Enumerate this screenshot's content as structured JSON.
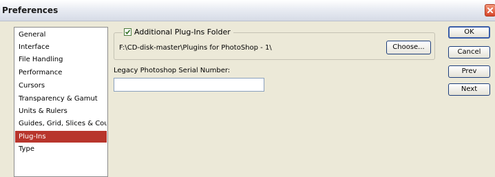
{
  "window": {
    "title": "Preferences"
  },
  "categories": [
    {
      "label": "General",
      "selected": false
    },
    {
      "label": "Interface",
      "selected": false
    },
    {
      "label": "File Handling",
      "selected": false
    },
    {
      "label": "Performance",
      "selected": false
    },
    {
      "label": "Cursors",
      "selected": false
    },
    {
      "label": "Transparency & Gamut",
      "selected": false
    },
    {
      "label": "Units & Rulers",
      "selected": false
    },
    {
      "label": "Guides, Grid, Slices & Count",
      "selected": false
    },
    {
      "label": "Plug-Ins",
      "selected": true
    },
    {
      "label": "Type",
      "selected": false
    }
  ],
  "plugins": {
    "checkbox_label": "Additional Plug-Ins Folder",
    "checked": true,
    "folder_path": "F:\\CD-disk-master\\Plugins for PhotoShop - 1\\",
    "choose_label": "Choose..."
  },
  "serial": {
    "label": "Legacy Photoshop Serial Number:",
    "value": ""
  },
  "buttons": {
    "ok": "OK",
    "cancel": "Cancel",
    "prev": "Prev",
    "next": "Next"
  },
  "colors": {
    "selected_bg": "#b8352c",
    "dialog_bg": "#ece9d8",
    "close_button": "#d6452a"
  }
}
